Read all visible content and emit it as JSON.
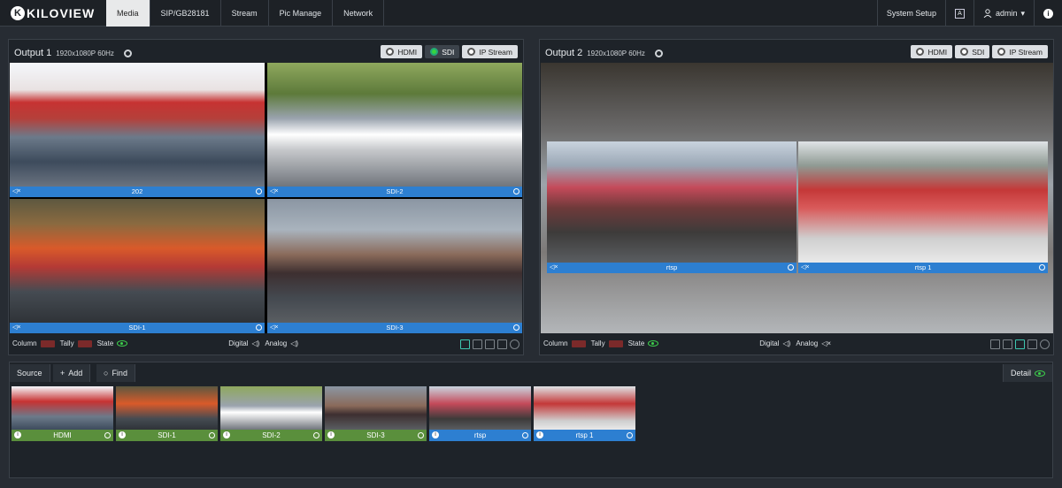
{
  "brand": {
    "logo_letter": "K",
    "logo_text": "KILOVIEW"
  },
  "nav": {
    "tabs": [
      "Media",
      "SIP/GB28181",
      "Stream",
      "Pic Manage",
      "Network"
    ],
    "active": "Media"
  },
  "header": {
    "system_setup": "System Setup",
    "user": "admin",
    "lang_icon": "A"
  },
  "output1": {
    "title": "Output 1",
    "resolution": "1920x1080P 60Hz",
    "sources": [
      "HDMI",
      "SDI",
      "IP Stream"
    ],
    "active_source": "SDI",
    "cells": [
      "202",
      "SDI-2",
      "SDI-1",
      "SDI-3"
    ],
    "controls": {
      "column": "Column",
      "tally": "Tally",
      "state": "State",
      "digital": "Digital",
      "analog": "Analog"
    }
  },
  "output2": {
    "title": "Output 2",
    "resolution": "1920x1080P 60Hz",
    "sources": [
      "HDMI",
      "SDI",
      "IP Stream"
    ],
    "cells": [
      "rtsp",
      "rtsp 1"
    ],
    "controls": {
      "column": "Column",
      "tally": "Tally",
      "state": "State",
      "digital": "Digital",
      "analog": "Analog"
    }
  },
  "sources_panel": {
    "source_tab": "Source",
    "add": "Add",
    "find": "Find",
    "detail": "Detail",
    "thumbs": [
      {
        "name": "HDMI",
        "type": "green"
      },
      {
        "name": "SDI-1",
        "type": "green"
      },
      {
        "name": "SDI-2",
        "type": "green"
      },
      {
        "name": "SDI-3",
        "type": "green"
      },
      {
        "name": "rtsp",
        "type": "blue"
      },
      {
        "name": "rtsp 1",
        "type": "blue"
      }
    ]
  },
  "colors": {
    "accent_blue": "#2d7fd1",
    "green_label": "#5a8f3c",
    "tally_red": "#7b2a2a",
    "state_green": "#3dd24c"
  }
}
